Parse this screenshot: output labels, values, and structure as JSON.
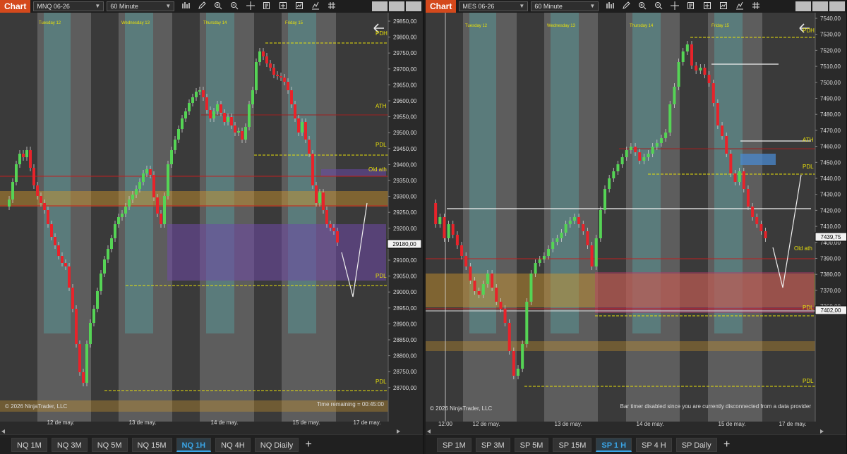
{
  "left": {
    "chart_button": "Chart",
    "instrument": "MNQ 06-26",
    "interval": "60 Minute",
    "day_labels": [
      "Tuesday 12",
      "Wednesday 13",
      "Thursday 14",
      "Friday 15"
    ],
    "x_labels": [
      "12 de may.",
      "13 de may.",
      "14 de may.",
      "15 de may.",
      "17 de may."
    ],
    "y_labels": [
      "29850,00",
      "29800,00",
      "29750,00",
      "29700,00",
      "29650,00",
      "29600,00",
      "29550,00",
      "29500,00",
      "29450,00",
      "29400,00",
      "29350,00",
      "29300,00",
      "29250,00",
      "29200,00",
      "29150,00",
      "29100,00",
      "29050,00",
      "29000,00",
      "28950,00",
      "28900,00",
      "28850,00",
      "28800,00",
      "28750,00",
      "28700,00"
    ],
    "level_labels": [
      "PDH",
      "ATH",
      "PDL",
      "Old ath",
      "PDL",
      "PDL"
    ],
    "price_box": "29180,00",
    "copyright": "© 2026 NinjaTrader, LLC",
    "status": "Time remaining = 00:45:00",
    "tabs": [
      "NQ 1M",
      "NQ 3M",
      "NQ 5M",
      "NQ 15M",
      "NQ 1H",
      "NQ 4H",
      "NQ Diaily"
    ],
    "active_tab": "NQ 1H"
  },
  "right": {
    "chart_button": "Chart",
    "instrument": "MES 06-26",
    "interval": "60 Minute",
    "day_labels": [
      "Tuesday 12",
      "Wednesday 13",
      "Thursday 14",
      "Friday 15"
    ],
    "x_labels": [
      "12:00",
      "12 de may.",
      "13 de may.",
      "14 de may.",
      "15 de may.",
      "17 de may."
    ],
    "y_labels": [
      "7540,00",
      "7530,00",
      "7520,00",
      "7510,00",
      "7500,00",
      "7490,00",
      "7480,00",
      "7470,00",
      "7460,00",
      "7450,00",
      "7440,00",
      "7430,00",
      "7420,00",
      "7410,00",
      "7400,00",
      "7390,00",
      "7380,00",
      "7370,00",
      "7360,00"
    ],
    "level_labels": [
      "PDH",
      "ATH",
      "PDL",
      "Old ath",
      "PDL",
      "PDL"
    ],
    "price_box": "7439,75",
    "price_box2": "7402,00",
    "copyright": "© 2026 NinjaTrader, LLC",
    "status": "Bar timer disabled since you are currently disconnected from a data provider",
    "tabs": [
      "SP 1M",
      "SP 3M",
      "SP 5M",
      "SP 15M",
      "SP 1 H",
      "SP 4 H",
      "SP Daily"
    ],
    "active_tab": "SP 1 H"
  },
  "colors": {
    "up": "#55d455",
    "down": "#e8232a",
    "level": "#e8e00a",
    "brand": "#d4491c",
    "accent": "#3aa6e8"
  },
  "icons": [
    "bar-chart-icon",
    "pencil-icon",
    "zoom-in-icon",
    "zoom-out-icon",
    "crosshair-icon",
    "data-box-icon",
    "properties-icon",
    "strategy-icon",
    "indicator-icon",
    "hash-icon"
  ],
  "add_tab_label": "+"
}
